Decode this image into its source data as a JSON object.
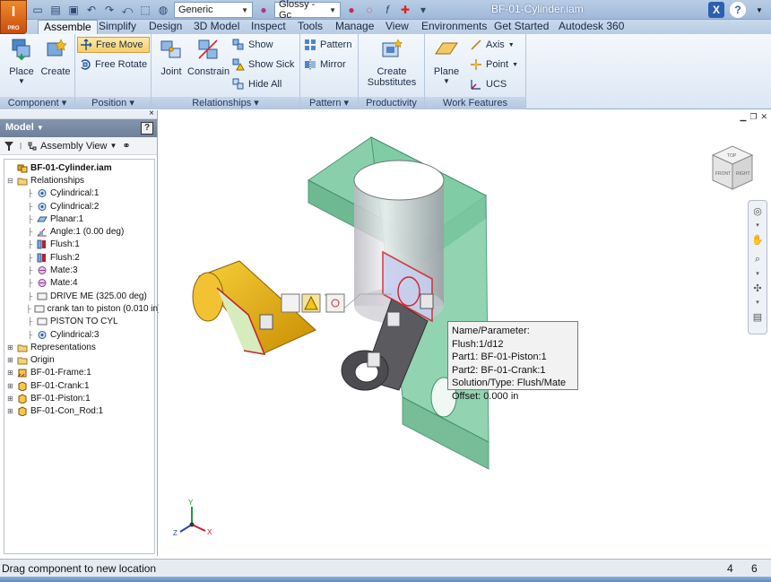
{
  "app": {
    "logo_letter": "I",
    "logo_sub": "PRO",
    "window_title": "BF-01-Cylinder.iam",
    "appearance_combo": "Generic",
    "material_combo": "Glossy - Gc"
  },
  "tabs": [
    {
      "label": "Assemble",
      "active": true
    },
    {
      "label": "Simplify"
    },
    {
      "label": "Design"
    },
    {
      "label": "3D Model"
    },
    {
      "label": "Inspect"
    },
    {
      "label": "Tools"
    },
    {
      "label": "Manage"
    },
    {
      "label": "View"
    },
    {
      "label": "Environments"
    },
    {
      "label": "Get Started"
    },
    {
      "label": "Autodesk 360"
    }
  ],
  "ribbon": {
    "component": {
      "title": "Component",
      "place": "Place",
      "create": "Create"
    },
    "position": {
      "title": "Position",
      "free_move": "Free Move",
      "free_rotate": "Free Rotate"
    },
    "relationships": {
      "title": "Relationships",
      "joint": "Joint",
      "constrain": "Constrain",
      "show": "Show",
      "show_sick": "Show Sick",
      "hide_all": "Hide All"
    },
    "pattern": {
      "title": "Pattern",
      "pattern": "Pattern",
      "mirror": "Mirror"
    },
    "productivity": {
      "title": "Productivity",
      "create_substitutes_1": "Create",
      "create_substitutes_2": "Substitutes"
    },
    "work_features": {
      "title": "Work Features",
      "plane": "Plane",
      "axis": "Axis",
      "point": "Point",
      "ucs": "UCS"
    }
  },
  "browser": {
    "header": "Model",
    "view_label": "Assembly View",
    "help": "?",
    "tree": [
      {
        "label": "BF-01-Cylinder.iam",
        "level": 0,
        "icon": "assembly-icon",
        "bold": true
      },
      {
        "label": "Relationships",
        "level": 0,
        "icon": "folder-icon",
        "expander": "-"
      },
      {
        "label": "Cylindrical:1",
        "level": 1,
        "icon": "joint-icon"
      },
      {
        "label": "Cylindrical:2",
        "level": 1,
        "icon": "joint-icon"
      },
      {
        "label": "Planar:1",
        "level": 1,
        "icon": "planar-icon"
      },
      {
        "label": "Angle:1 (0.00 deg)",
        "level": 1,
        "icon": "angle-icon"
      },
      {
        "label": "Flush:1",
        "level": 1,
        "icon": "flush-icon"
      },
      {
        "label": "Flush:2",
        "level": 1,
        "icon": "flush-icon"
      },
      {
        "label": "Mate:3",
        "level": 1,
        "icon": "mate-icon"
      },
      {
        "label": "Mate:4",
        "level": 1,
        "icon": "mate-icon"
      },
      {
        "label": "DRIVE ME (325.00 deg)",
        "level": 1,
        "icon": "constraint-icon"
      },
      {
        "label": "crank tan to piston (0.010 in)",
        "level": 1,
        "icon": "constraint-icon"
      },
      {
        "label": "PISTON TO CYL",
        "level": 1,
        "icon": "constraint-icon"
      },
      {
        "label": "Cylindrical:3",
        "level": 1,
        "icon": "joint-icon"
      },
      {
        "label": "Representations",
        "level": 0,
        "icon": "folder-icon",
        "expander": "+"
      },
      {
        "label": "Origin",
        "level": 0,
        "icon": "folder-icon",
        "expander": "+"
      },
      {
        "label": "BF-01-Frame:1",
        "level": 0,
        "icon": "grounded-part-icon",
        "expander": "+"
      },
      {
        "label": "BF-01-Crank:1",
        "level": 0,
        "icon": "part-icon",
        "expander": "+"
      },
      {
        "label": "BF-01-Piston:1",
        "level": 0,
        "icon": "part-icon",
        "expander": "+"
      },
      {
        "label": "BF-01-Con_Rod:1",
        "level": 0,
        "icon": "part-icon",
        "expander": "+"
      }
    ]
  },
  "tooltip": {
    "line1": "Name/Parameter: Flush:1/d12",
    "line2": "Part1: BF-01-Piston:1",
    "line3": "Part2: BF-01-Crank:1",
    "line4": "Solution/Type: Flush/Mate",
    "line5": "Offset: 0.000 in"
  },
  "viewcube": {
    "top": "TOP",
    "front": "FRONT",
    "right": "RIGHT"
  },
  "triad": {
    "x": "X",
    "y": "Y",
    "z": "Z"
  },
  "status": {
    "message": "Drag component to new location",
    "count1": "4",
    "count2": "6"
  },
  "colors": {
    "frame": "#6fc29a",
    "crank": "#e8b40c",
    "con_rod": "#4a4a4a",
    "piston": "#d9d9d9",
    "constraint": "#d3232a"
  }
}
